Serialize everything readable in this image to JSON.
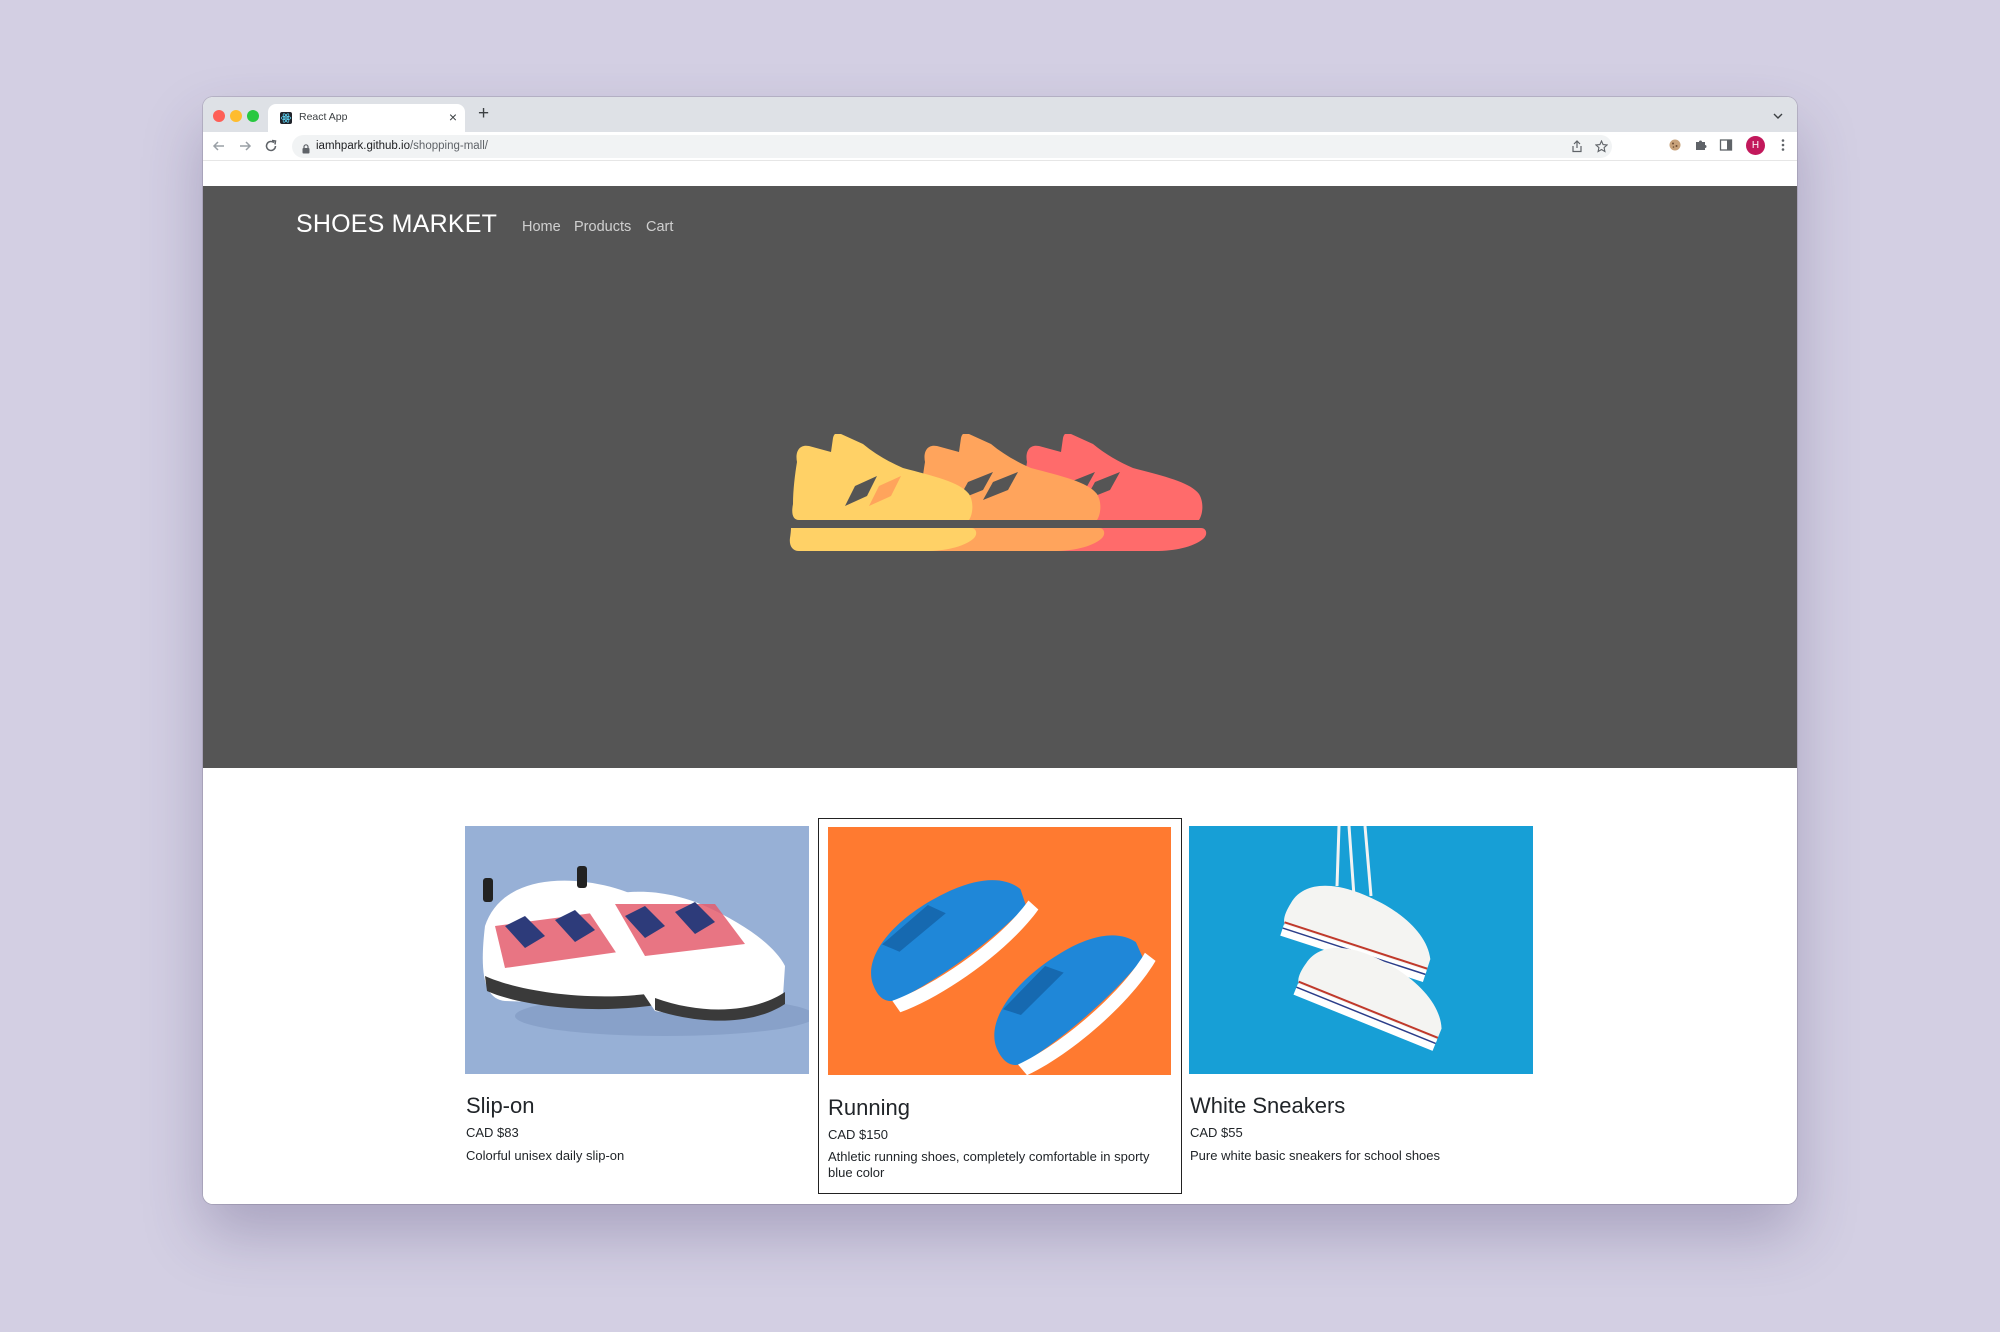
{
  "browser": {
    "tab_title": "React App",
    "tab_close": "×",
    "new_tab": "+",
    "url_domain": "iamhpark.github.io",
    "url_path": "/shopping-mall/",
    "profile_initial": "H"
  },
  "site": {
    "brand": "SHOES MARKET",
    "nav": [
      "Home",
      "Products",
      "Cart"
    ],
    "hero_colors": [
      "#ffd166",
      "#ffa45c",
      "#ff6b6b"
    ]
  },
  "products": [
    {
      "name": "Slip-on",
      "price": "CAD $83",
      "description": "Colorful unisex daily slip-on",
      "bg": "#97b0d6"
    },
    {
      "name": "Running",
      "price": "CAD $150",
      "description": "Athletic running shoes, completely comfortable in sporty blue color",
      "bg": "#ff7a30"
    },
    {
      "name": "White Sneakers",
      "price": "CAD $55",
      "description": "Pure white basic sneakers for school shoes",
      "bg": "#179fd6"
    }
  ]
}
